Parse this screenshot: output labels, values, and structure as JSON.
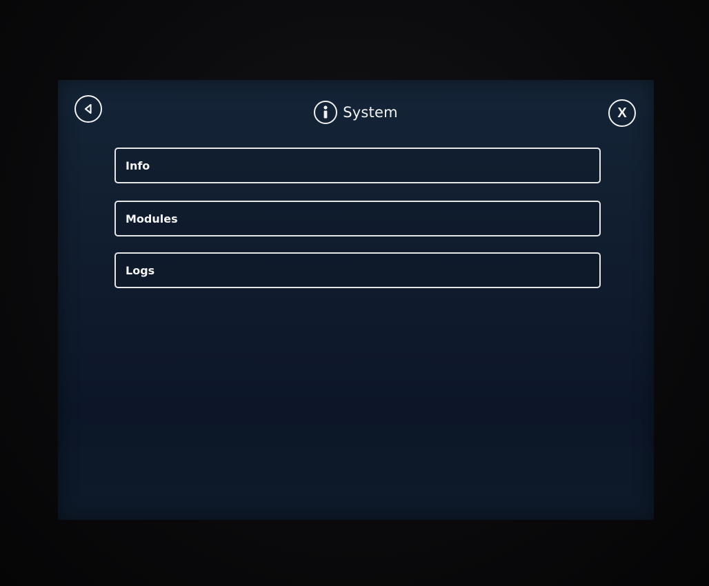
{
  "header": {
    "title": "System",
    "back_icon": "back-triangle-icon",
    "close_label": "X",
    "title_icon": "info-icon"
  },
  "menu": {
    "items": [
      {
        "label": "Info"
      },
      {
        "label": "Modules"
      },
      {
        "label": "Logs"
      }
    ]
  },
  "colors": {
    "screen_bg": "#101c2e",
    "foreground": "#f2f2f2"
  }
}
